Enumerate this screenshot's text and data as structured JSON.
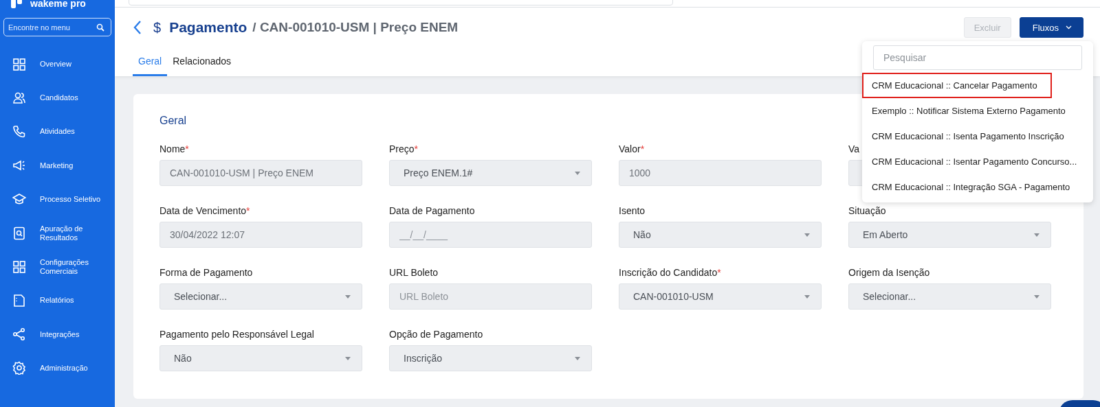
{
  "sidebar": {
    "brand": "wakeme pro",
    "search": {
      "placeholder": "Encontre no menu"
    },
    "items": [
      {
        "label": "Overview",
        "kind": "grid"
      },
      {
        "label": "Candidatos",
        "kind": "users"
      },
      {
        "label": "Atividades",
        "kind": "phone"
      },
      {
        "label": "Marketing",
        "kind": "megaphone"
      },
      {
        "label": "Processo Seletivo",
        "kind": "cap"
      },
      {
        "label": "Apuração de Resultados",
        "kind": "docsearch"
      },
      {
        "label": "Configurações Comerciais",
        "kind": "grid"
      },
      {
        "label": "Relatórios",
        "kind": "report"
      },
      {
        "label": "Integrações",
        "kind": "share"
      },
      {
        "label": "Administração",
        "kind": "gear"
      }
    ]
  },
  "header": {
    "symbol": "$",
    "section": "Pagamento",
    "record": "/ CAN-001010-USM | Preço ENEM",
    "buttons": [
      {
        "label": "Excluir",
        "disabled": true
      },
      {
        "label": "Fluxos",
        "disabled": false
      }
    ]
  },
  "tabs": [
    {
      "label": "Geral",
      "selected": true
    },
    {
      "label": "Relacionados",
      "selected": false
    }
  ],
  "form": {
    "title": "Geral",
    "required_mark": "*",
    "fields": [
      {
        "label": "Nome",
        "required": true,
        "kind": "text",
        "value": "CAN-001010-USM | Preço ENEM"
      },
      {
        "label": "Preço",
        "required": true,
        "kind": "select",
        "value": "Preço ENEM.1#"
      },
      {
        "label": "Valor",
        "required": true,
        "kind": "text",
        "value": "1000"
      },
      {
        "label": "Va",
        "required": false,
        "kind": "text"
      },
      {
        "label": "Data de Vencimento",
        "required": true,
        "kind": "text",
        "value": "30/04/2022 12:07"
      },
      {
        "label": "Data de Pagamento",
        "required": false,
        "kind": "text",
        "placeholder": "__/__/____"
      },
      {
        "label": "Isento",
        "required": false,
        "kind": "select",
        "value": "Não"
      },
      {
        "label": "Situação",
        "required": false,
        "kind": "select",
        "value": "Em Aberto"
      },
      {
        "label": "Forma de Pagamento",
        "required": false,
        "kind": "select",
        "value": "Selecionar..."
      },
      {
        "label": "URL Boleto",
        "required": false,
        "kind": "text",
        "placeholder": "URL Boleto"
      },
      {
        "label": "Inscrição do Candidato",
        "required": true,
        "kind": "select",
        "value": "CAN-001010-USM"
      },
      {
        "label": "Origem da Isenção",
        "required": false,
        "kind": "select",
        "value": "Selecionar..."
      },
      {
        "label": "Pagamento pelo Responsável Legal",
        "required": false,
        "kind": "select",
        "value": "Não"
      },
      {
        "label": "Opção de Pagamento",
        "required": false,
        "kind": "select",
        "value": "Inscrição"
      }
    ]
  },
  "flows_menu": {
    "search": {
      "placeholder": "Pesquisar"
    },
    "items": [
      {
        "label": "CRM Educacional :: Cancelar Pagamento",
        "highlighted": true
      },
      {
        "label": "Exemplo :: Notificar Sistema Externo Pagamento",
        "highlighted": false
      },
      {
        "label": "CRM Educacional :: Isenta Pagamento Inscrição",
        "highlighted": false
      },
      {
        "label": "CRM Educacional :: Isentar Pagamento Concurso...",
        "highlighted": false
      },
      {
        "label": "CRM Educacional :: Integração SGA - Pagamento",
        "highlighted": false
      }
    ]
  }
}
